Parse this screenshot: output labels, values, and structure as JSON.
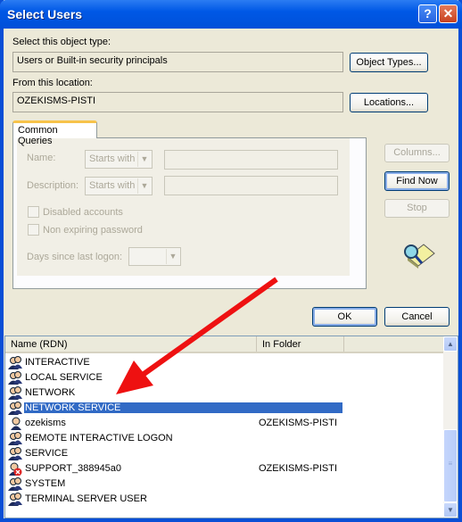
{
  "window": {
    "title": "Select Users",
    "help_label": "?",
    "close_label": "✕"
  },
  "object_type": {
    "label": "Select this object type:",
    "value": "Users or Built-in security principals",
    "button": "Object Types..."
  },
  "location": {
    "label": "From this location:",
    "value": "OZEKISMS-PISTI",
    "button": "Locations..."
  },
  "common_queries": {
    "tab_label": "Common Queries",
    "name_label": "Name:",
    "name_mode": "Starts with",
    "name_value": "",
    "description_label": "Description:",
    "description_mode": "Starts with",
    "description_value": "",
    "disabled_accounts": {
      "label": "Disabled accounts",
      "checked": false
    },
    "non_expiring_password": {
      "label": "Non expiring password",
      "checked": false
    },
    "days_label": "Days since last logon:",
    "days_value": ""
  },
  "side_buttons": {
    "columns": "Columns...",
    "find_now": "Find Now",
    "stop": "Stop"
  },
  "dialog_buttons": {
    "ok": "OK",
    "cancel": "Cancel"
  },
  "results": {
    "columns": [
      "Name (RDN)",
      "In Folder"
    ],
    "selected_index": 3,
    "rows": [
      {
        "name": "INTERACTIVE",
        "folder": "",
        "icon": "group-icon"
      },
      {
        "name": "LOCAL SERVICE",
        "folder": "",
        "icon": "group-icon"
      },
      {
        "name": "NETWORK",
        "folder": "",
        "icon": "group-icon"
      },
      {
        "name": "NETWORK SERVICE",
        "folder": "",
        "icon": "group-icon"
      },
      {
        "name": "ozekisms",
        "folder": "OZEKISMS-PISTI",
        "icon": "user-icon"
      },
      {
        "name": "REMOTE INTERACTIVE LOGON",
        "folder": "",
        "icon": "group-icon"
      },
      {
        "name": "SERVICE",
        "folder": "",
        "icon": "group-icon"
      },
      {
        "name": "SUPPORT_388945a0",
        "folder": "OZEKISMS-PISTI",
        "icon": "disabled-user-icon"
      },
      {
        "name": "SYSTEM",
        "folder": "",
        "icon": "group-icon"
      },
      {
        "name": "TERMINAL SERVER USER",
        "folder": "",
        "icon": "group-icon"
      }
    ]
  },
  "colors": {
    "titlebar": "#0058e6",
    "selection": "#316ac5",
    "annotation_arrow": "#ee1111"
  }
}
